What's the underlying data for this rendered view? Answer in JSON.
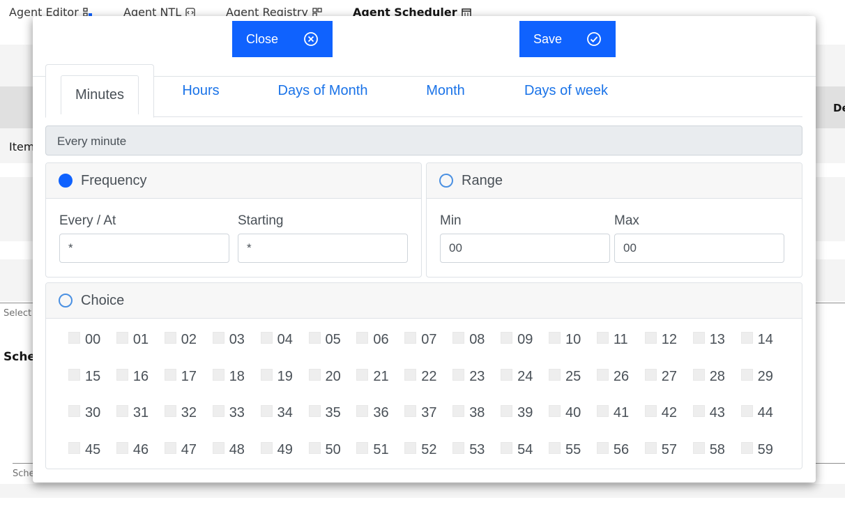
{
  "app_tabs": [
    {
      "label": "Agent Editor",
      "icon": "flow-icon"
    },
    {
      "label": "Agent NTL",
      "icon": "code-icon"
    },
    {
      "label": "Agent Registry",
      "icon": "registry-icon"
    },
    {
      "label": "Agent Scheduler",
      "icon": "calendar-icon"
    }
  ],
  "background": {
    "item_label": "Item",
    "col_header": "De",
    "select_label": "Select",
    "schedule_heading": "Sche",
    "schedule_footer": "Sche"
  },
  "modal": {
    "close_label": "Close",
    "save_label": "Save",
    "tabs": [
      "Minutes",
      "Hours",
      "Days of Month",
      "Month",
      "Days of week"
    ],
    "active_tab": "Minutes",
    "summary": "Every minute",
    "frequency": {
      "title": "Frequency",
      "selected": true,
      "every_label": "Every / At",
      "every_value": "*",
      "starting_label": "Starting",
      "starting_value": "*"
    },
    "range": {
      "title": "Range",
      "selected": false,
      "min_label": "Min",
      "min_value": "00",
      "max_label": "Max",
      "max_value": "00"
    },
    "choice": {
      "title": "Choice",
      "selected": false,
      "options": [
        "00",
        "01",
        "02",
        "03",
        "04",
        "05",
        "06",
        "07",
        "08",
        "09",
        "10",
        "11",
        "12",
        "13",
        "14",
        "15",
        "16",
        "17",
        "18",
        "19",
        "20",
        "21",
        "22",
        "23",
        "24",
        "25",
        "26",
        "27",
        "28",
        "29",
        "30",
        "31",
        "32",
        "33",
        "34",
        "35",
        "36",
        "37",
        "38",
        "39",
        "40",
        "41",
        "42",
        "43",
        "44",
        "45",
        "46",
        "47",
        "48",
        "49",
        "50",
        "51",
        "52",
        "53",
        "54",
        "55",
        "56",
        "57",
        "58",
        "59"
      ]
    }
  },
  "colors": {
    "primary": "#0f62fe",
    "tab_link": "#1a73e8",
    "radio_outline": "#4a90e2"
  }
}
